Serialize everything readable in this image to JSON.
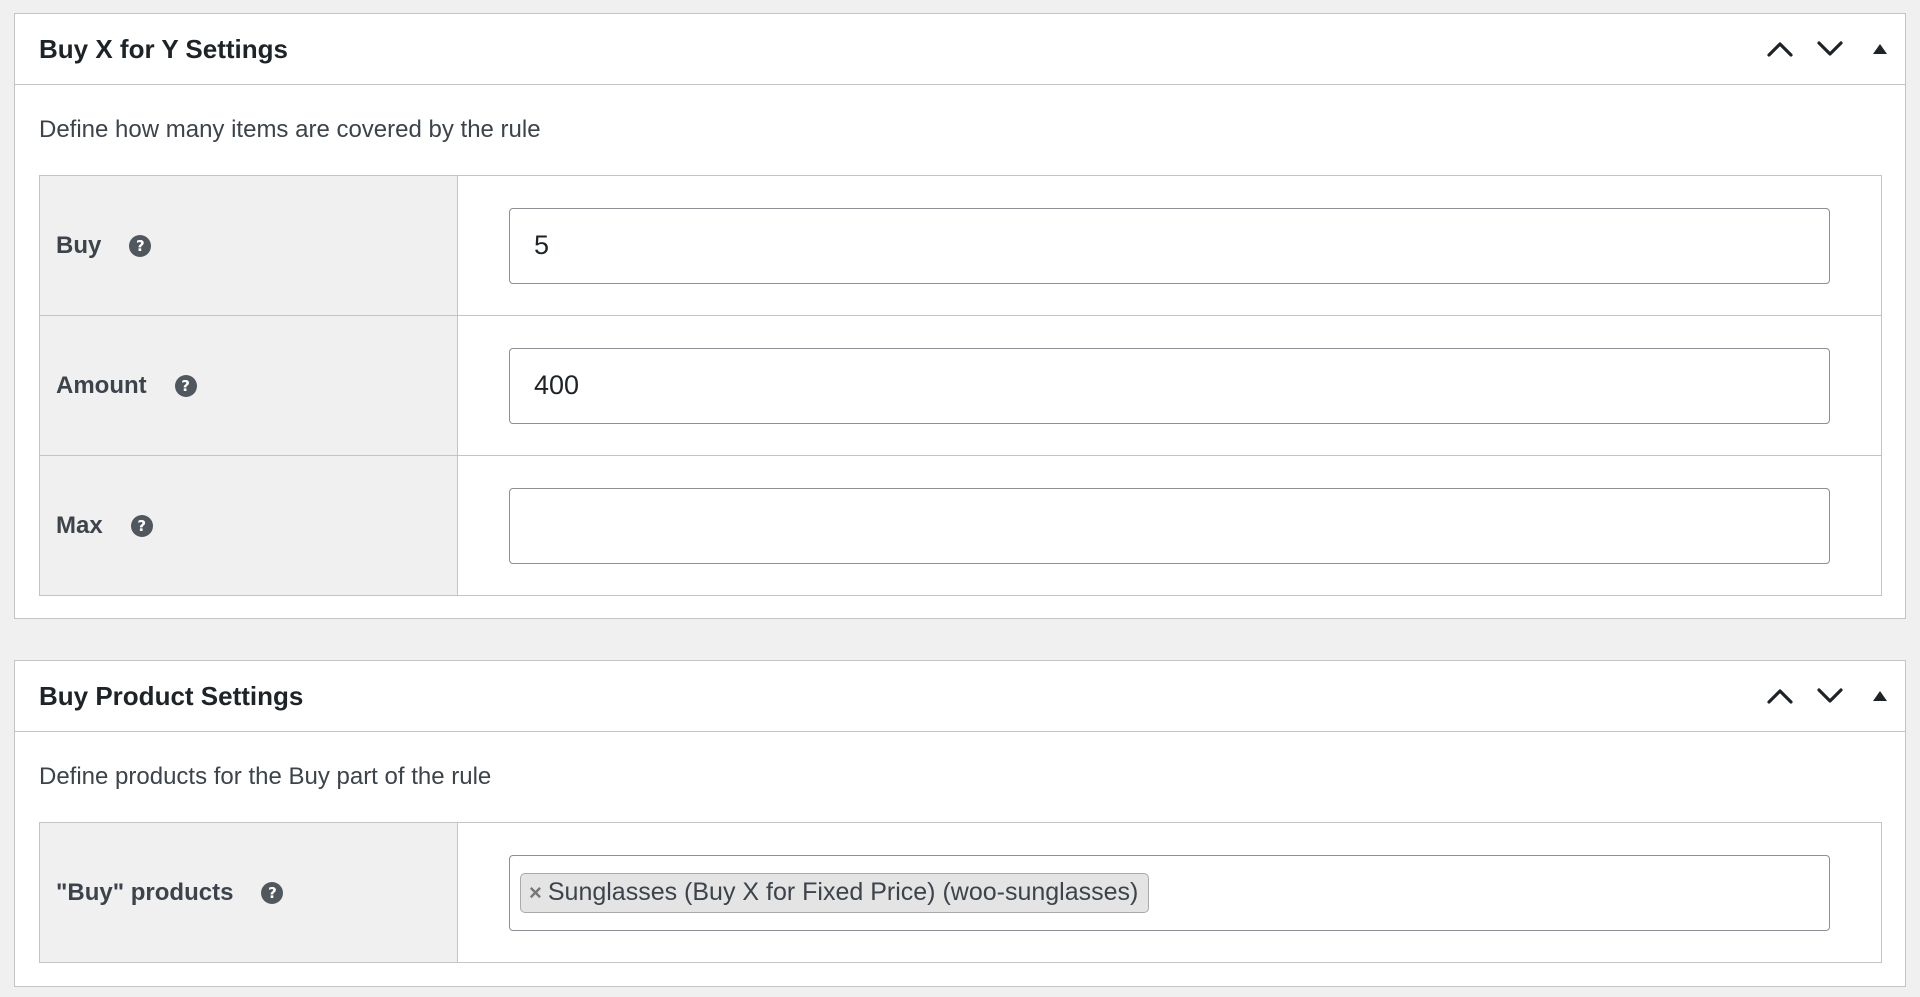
{
  "buy_x_box": {
    "title": "Buy X for Y Settings",
    "description": "Define how many items are covered by the rule",
    "fields": [
      {
        "label": "Buy",
        "value": "5",
        "help_icon": "question-circle-icon"
      },
      {
        "label": "Amount",
        "value": "400",
        "help_icon": "question-circle-icon"
      },
      {
        "label": "Max",
        "value": "",
        "help_icon": "question-circle-icon"
      }
    ]
  },
  "buy_product_box": {
    "title": "Buy Product Settings",
    "description": "Define products for the Buy part of the rule",
    "field": {
      "label": "\"Buy\" products",
      "help_icon": "question-circle-icon",
      "selected": [
        {
          "remove_glyph": "×",
          "text": "Sunglasses (Buy X for Fixed Price) (woo-sunglasses)"
        }
      ]
    }
  },
  "help_glyph": "?",
  "handle_icons": [
    "chevron-up-icon",
    "chevron-down-icon",
    "toggle-arrow-icon"
  ]
}
